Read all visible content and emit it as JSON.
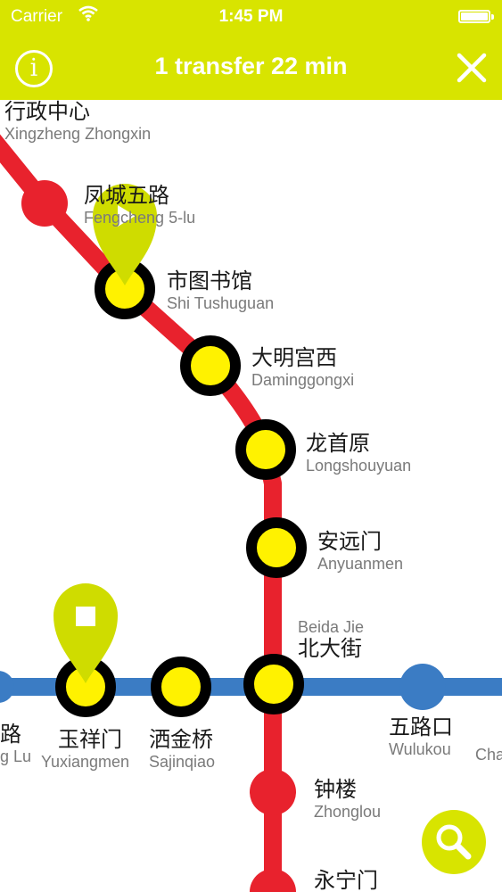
{
  "status_bar": {
    "carrier": "Carrier",
    "time": "1:45 PM"
  },
  "nav_bar": {
    "info_label": "i",
    "title": "1 transfer 22 min"
  },
  "colors": {
    "accent": "#d8e400",
    "red_line": "#e8222d",
    "blue_line": "#3b7cc4",
    "station_fill": "#fff200",
    "station_ring": "#000000"
  },
  "icons": {
    "info": "info-icon",
    "close": "close-icon",
    "start_pin": "play-pin-icon",
    "end_pin": "stop-pin-icon",
    "search": "search-icon"
  },
  "stations": {
    "xingzheng_zhongxin": {
      "cn": "行政中心",
      "en": "Xingzheng Zhongxin"
    },
    "fengcheng_5lu": {
      "cn": "凤城五路",
      "en": "Fengcheng 5-lu"
    },
    "shi_tushuguan": {
      "cn": "市图书馆",
      "en": "Shi Tushuguan"
    },
    "daminggongxi": {
      "cn": "大明宫西",
      "en": "Daminggongxi"
    },
    "longshouyuan": {
      "cn": "龙首原",
      "en": "Longshouyuan"
    },
    "anyuanmen": {
      "cn": "安远门",
      "en": "Anyuanmen"
    },
    "beida_jie": {
      "cn": "北大街",
      "en": "Beida Jie"
    },
    "zhonglou": {
      "cn": "钟楼",
      "en": "Zhonglou"
    },
    "yongningmen": {
      "cn": "永宁门",
      "en": ""
    },
    "wulukou": {
      "cn": "五路口",
      "en": "Wulukou"
    },
    "sajinqiao": {
      "cn": "洒金桥",
      "en": "Sajinqiao"
    },
    "yuxiangmen": {
      "cn": "玉祥门",
      "en": "Yuxiangmen"
    },
    "left_cut": {
      "cn": "路",
      "en": "g Lu"
    },
    "right_cut": {
      "cn": "",
      "en": "Cha"
    }
  }
}
